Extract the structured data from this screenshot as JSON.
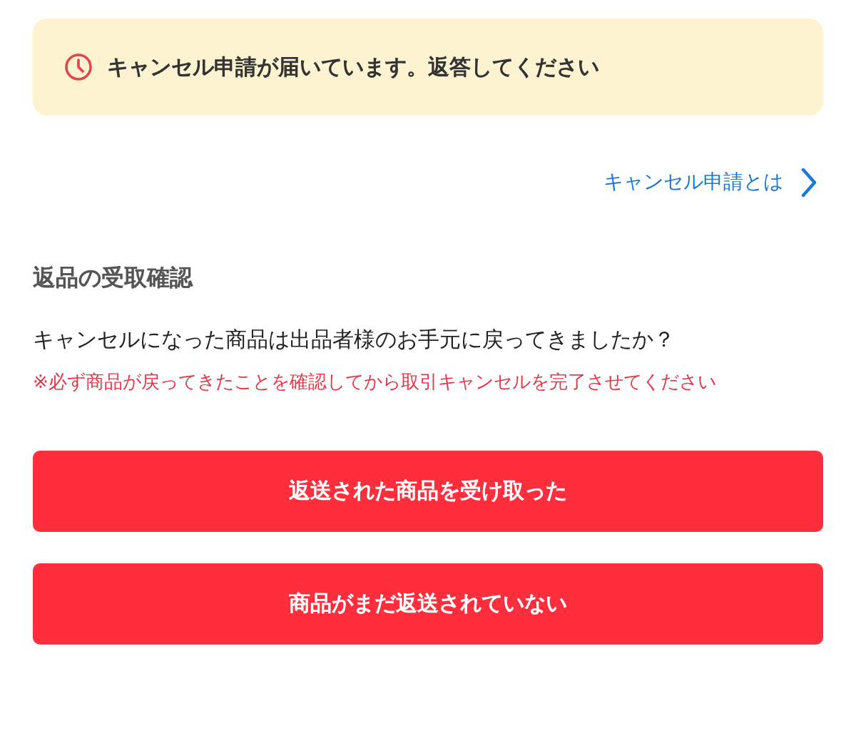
{
  "notice": {
    "text": "キャンセル申請が届いています。返答してください"
  },
  "help_link": {
    "label": "キャンセル申請とは"
  },
  "section": {
    "title": "返品の受取確認",
    "question": "キャンセルになった商品は出品者様のお手元に戻ってきましたか？",
    "warning": "※必ず商品が戻ってきたことを確認してから取引キャンセルを完了させてください"
  },
  "buttons": [
    "返送された商品を受け取った",
    "商品がまだ返送されていない"
  ]
}
